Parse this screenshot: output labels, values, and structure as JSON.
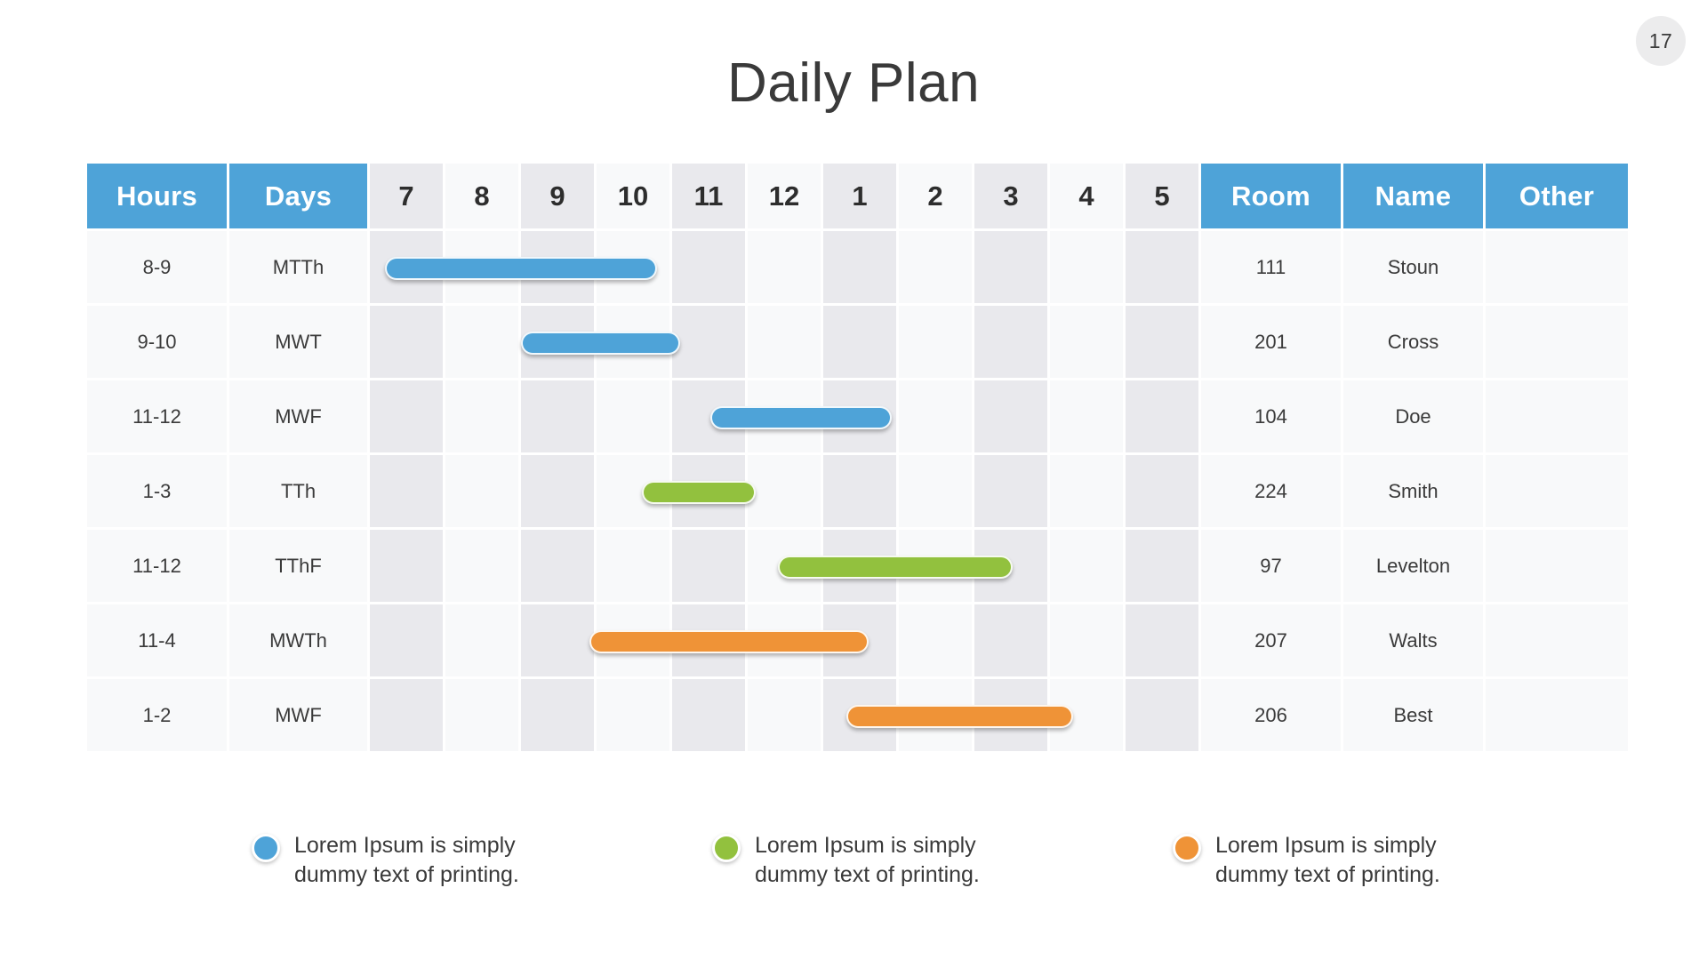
{
  "page_number": "17",
  "title": "Daily Plan",
  "colors": {
    "header_blue": "#4ea3d8",
    "bar_blue": "#4ea3d8",
    "bar_green": "#92c13e",
    "bar_orange": "#ef9337",
    "column_odd": "#e9e9ed",
    "column_even": "#f8f9fa"
  },
  "table": {
    "headers": {
      "hours": "Hours",
      "days": "Days",
      "room": "Room",
      "name": "Name",
      "other": "Other"
    },
    "hour_columns": [
      "7",
      "8",
      "9",
      "10",
      "11",
      "12",
      "1",
      "2",
      "3",
      "4",
      "5"
    ],
    "rows": [
      {
        "hours": "8-9",
        "days": "MTTh",
        "room": "111",
        "name": "Stoun",
        "other": ""
      },
      {
        "hours": "9-10",
        "days": "MWT",
        "room": "201",
        "name": "Cross",
        "other": ""
      },
      {
        "hours": "11-12",
        "days": "MWF",
        "room": "104",
        "name": "Doe",
        "other": ""
      },
      {
        "hours": "1-3",
        "days": "TTh",
        "room": "224",
        "name": "Smith",
        "other": ""
      },
      {
        "hours": "11-12",
        "days": "TThF",
        "room": "97",
        "name": "Levelton",
        "other": ""
      },
      {
        "hours": "11-4",
        "days": "MWTh",
        "room": "207",
        "name": "Walts",
        "other": ""
      },
      {
        "hours": "1-2",
        "days": "MWF",
        "room": "206",
        "name": "Best",
        "other": ""
      }
    ]
  },
  "legend": [
    {
      "color": "#4ea3d8",
      "text": "Lorem Ipsum is simply dummy text of printing."
    },
    {
      "color": "#92c13e",
      "text": "Lorem Ipsum is simply dummy text of printing."
    },
    {
      "color": "#ef9337",
      "text": "Lorem Ipsum is simply dummy text of printing."
    }
  ],
  "chart_data": {
    "type": "bar",
    "title": "Daily Plan",
    "xlabel": "",
    "ylabel": "",
    "categories": [
      "8-9 MTTh",
      "9-10 MWT",
      "11-12 MWF",
      "1-3 TTh",
      "11-12 TThF",
      "11-4 MWTh",
      "1-2 MWF"
    ],
    "x_tick_labels": [
      "7",
      "8",
      "9",
      "10",
      "11",
      "12",
      "1",
      "2",
      "3",
      "4",
      "5"
    ],
    "legend_position": "bottom",
    "grid": true,
    "bars": [
      {
        "row": 0,
        "label": "8-9 MTTh",
        "color_name": "blue",
        "color": "#4ea3d8",
        "start_hour": "7",
        "end_hour": "10",
        "start_col": 0.2,
        "span_cols": 3.6
      },
      {
        "row": 1,
        "label": "9-10 MWT",
        "color_name": "blue",
        "color": "#4ea3d8",
        "start_hour": "9",
        "end_hour": "11",
        "start_col": 2.0,
        "span_cols": 2.1
      },
      {
        "row": 2,
        "label": "11-12 MWF",
        "color_name": "blue",
        "color": "#4ea3d8",
        "start_hour": "11",
        "end_hour": "2",
        "start_col": 4.5,
        "span_cols": 2.4
      },
      {
        "row": 3,
        "label": "1-3 TTh",
        "color_name": "green",
        "color": "#92c13e",
        "start_hour": "11",
        "end_hour": "12",
        "start_col": 3.6,
        "span_cols": 1.5
      },
      {
        "row": 4,
        "label": "11-12 TThF",
        "color_name": "green",
        "color": "#92c13e",
        "start_hour": "1",
        "end_hour": "3",
        "start_col": 5.4,
        "span_cols": 3.1
      },
      {
        "row": 5,
        "label": "11-4 MWTh",
        "color_name": "orange",
        "color": "#ef9337",
        "start_hour": "9",
        "end_hour": "2",
        "start_col": 2.9,
        "span_cols": 3.7
      },
      {
        "row": 6,
        "label": "1-2 MWF",
        "color_name": "orange",
        "color": "#ef9337",
        "start_hour": "12",
        "end_hour": "4",
        "start_col": 6.3,
        "span_cols": 3.0
      }
    ]
  }
}
